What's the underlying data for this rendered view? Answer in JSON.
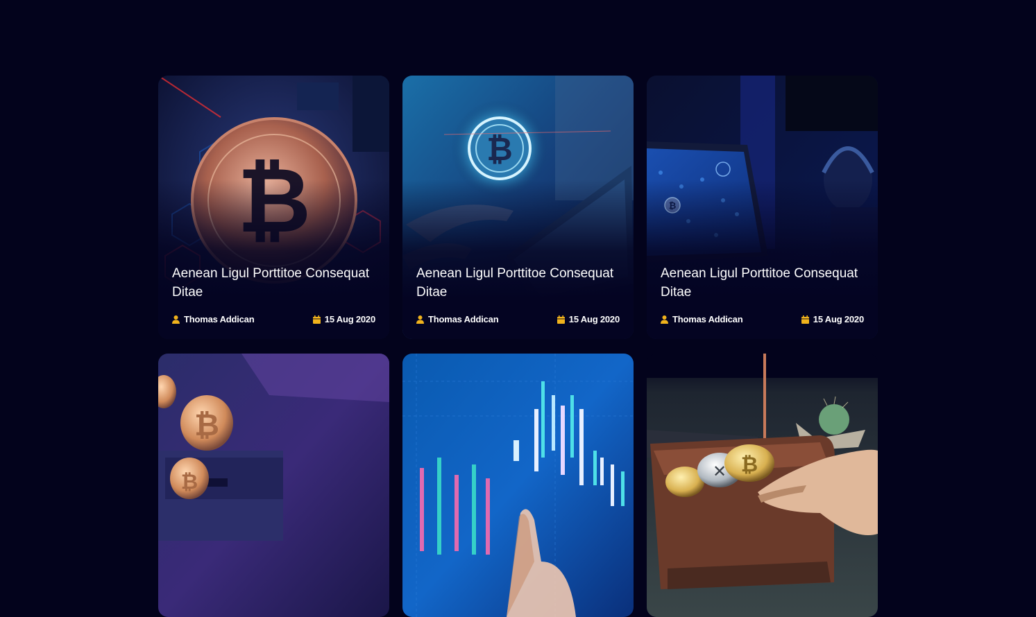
{
  "colors": {
    "background": "#03031c",
    "accent": "#f1b31c",
    "text": "#ffffff"
  },
  "cards": [
    {
      "title": "Aenean Ligul Porttitoe Consequat Ditae",
      "author": "Thomas Addican",
      "date": "15 Aug 2020",
      "image": "bitcoin-coin-on-circuit-board"
    },
    {
      "title": "Aenean Ligul Porttitoe Consequat Ditae",
      "author": "Thomas Addican",
      "date": "15 Aug 2020",
      "image": "hand-with-tablet-bitcoin-hologram"
    },
    {
      "title": "Aenean Ligul Porttitoe Consequat Ditae",
      "author": "Thomas Addican",
      "date": "15 Aug 2020",
      "image": "laptop-crypto-world-map"
    },
    {
      "image": "bitcoins-falling-into-box"
    },
    {
      "image": "candlestick-chart-finger"
    },
    {
      "image": "wallet-with-crypto-coins"
    }
  ]
}
